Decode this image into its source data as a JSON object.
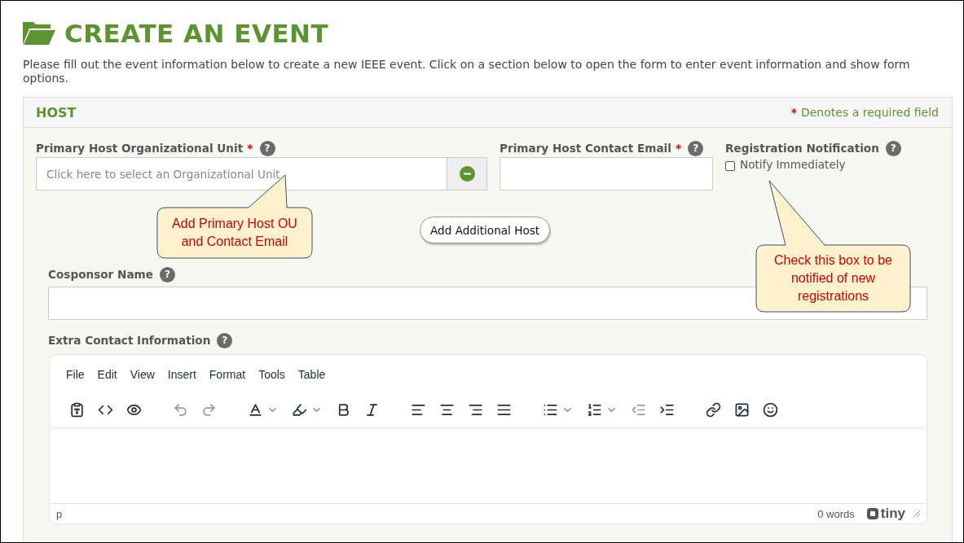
{
  "page": {
    "title": "CREATE AN EVENT",
    "description": "Please fill out the event information below to create a new IEEE event. Click on a section below to open the form to enter event information and show form options."
  },
  "host_section": {
    "title": "HOST",
    "required_note_mark": "*",
    "required_note": "Denotes a required field",
    "fields": [
      {
        "kind": "select",
        "label": "Primary Host Organizational Unit",
        "required_mark": "*",
        "help": "?",
        "placeholder": "Click here to select an Organizational Unit"
      },
      {
        "kind": "text",
        "label": "Primary Host Contact Email",
        "required_mark": "*",
        "help": "?"
      },
      {
        "kind": "checkbox",
        "label": "Registration Notification",
        "help": "?",
        "option": "Notify Immediately",
        "checked": false
      }
    ],
    "add_host_button": "Add Additional Host",
    "cosponsor": {
      "label": "Cosponsor Name",
      "help": "?"
    },
    "extra_contact": {
      "label": "Extra Contact Information",
      "help": "?"
    }
  },
  "editor": {
    "menu": [
      "File",
      "Edit",
      "View",
      "Insert",
      "Format",
      "Tools",
      "Table"
    ],
    "toolbar": [
      [
        {
          "kind": "paste-text",
          "disabled": false
        },
        {
          "kind": "code",
          "disabled": false
        },
        {
          "kind": "preview",
          "disabled": false
        }
      ],
      [
        {
          "kind": "undo",
          "disabled": true
        },
        {
          "kind": "redo",
          "disabled": true
        }
      ],
      [
        {
          "kind": "text-color",
          "disabled": false,
          "dropdown": true
        },
        {
          "kind": "highlight",
          "disabled": false,
          "dropdown": true
        },
        {
          "kind": "bold",
          "disabled": false
        },
        {
          "kind": "italic",
          "disabled": false
        }
      ],
      [
        {
          "kind": "align-left",
          "disabled": false
        },
        {
          "kind": "align-center",
          "disabled": false
        },
        {
          "kind": "align-right",
          "disabled": false
        },
        {
          "kind": "justify",
          "disabled": false
        }
      ],
      [
        {
          "kind": "bullet-list",
          "disabled": false,
          "dropdown": true
        },
        {
          "kind": "numbered-list",
          "disabled": false,
          "dropdown": true
        },
        {
          "kind": "outdent",
          "disabled": true
        },
        {
          "kind": "indent",
          "disabled": false
        }
      ],
      [
        {
          "kind": "link",
          "disabled": false
        },
        {
          "kind": "image",
          "disabled": false
        },
        {
          "kind": "emoji",
          "disabled": false
        }
      ]
    ],
    "path": "p",
    "word_count": "0 words",
    "brand": "tiny"
  },
  "callouts": [
    {
      "text": "Add Primary Host OU and Contact Email"
    },
    {
      "text": "Check this box to be notified of new registrations"
    }
  ]
}
